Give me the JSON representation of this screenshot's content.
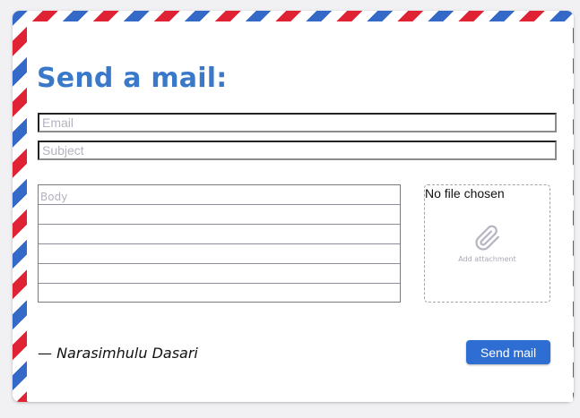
{
  "form": {
    "title": "Send a mail:",
    "email_placeholder": "Email",
    "subject_placeholder": "Subject",
    "body_placeholder": "Body",
    "file_status": "No file chosen",
    "attachment_label": "Add attachment",
    "attachment_icon": "paperclip-icon",
    "author": "— Narasimhulu Dasari",
    "send_label": "Send mail"
  },
  "colors": {
    "stripe_blue": "#3569c8",
    "stripe_red": "#e02334",
    "title": "#3a78c9",
    "button": "#2e6ed3"
  }
}
